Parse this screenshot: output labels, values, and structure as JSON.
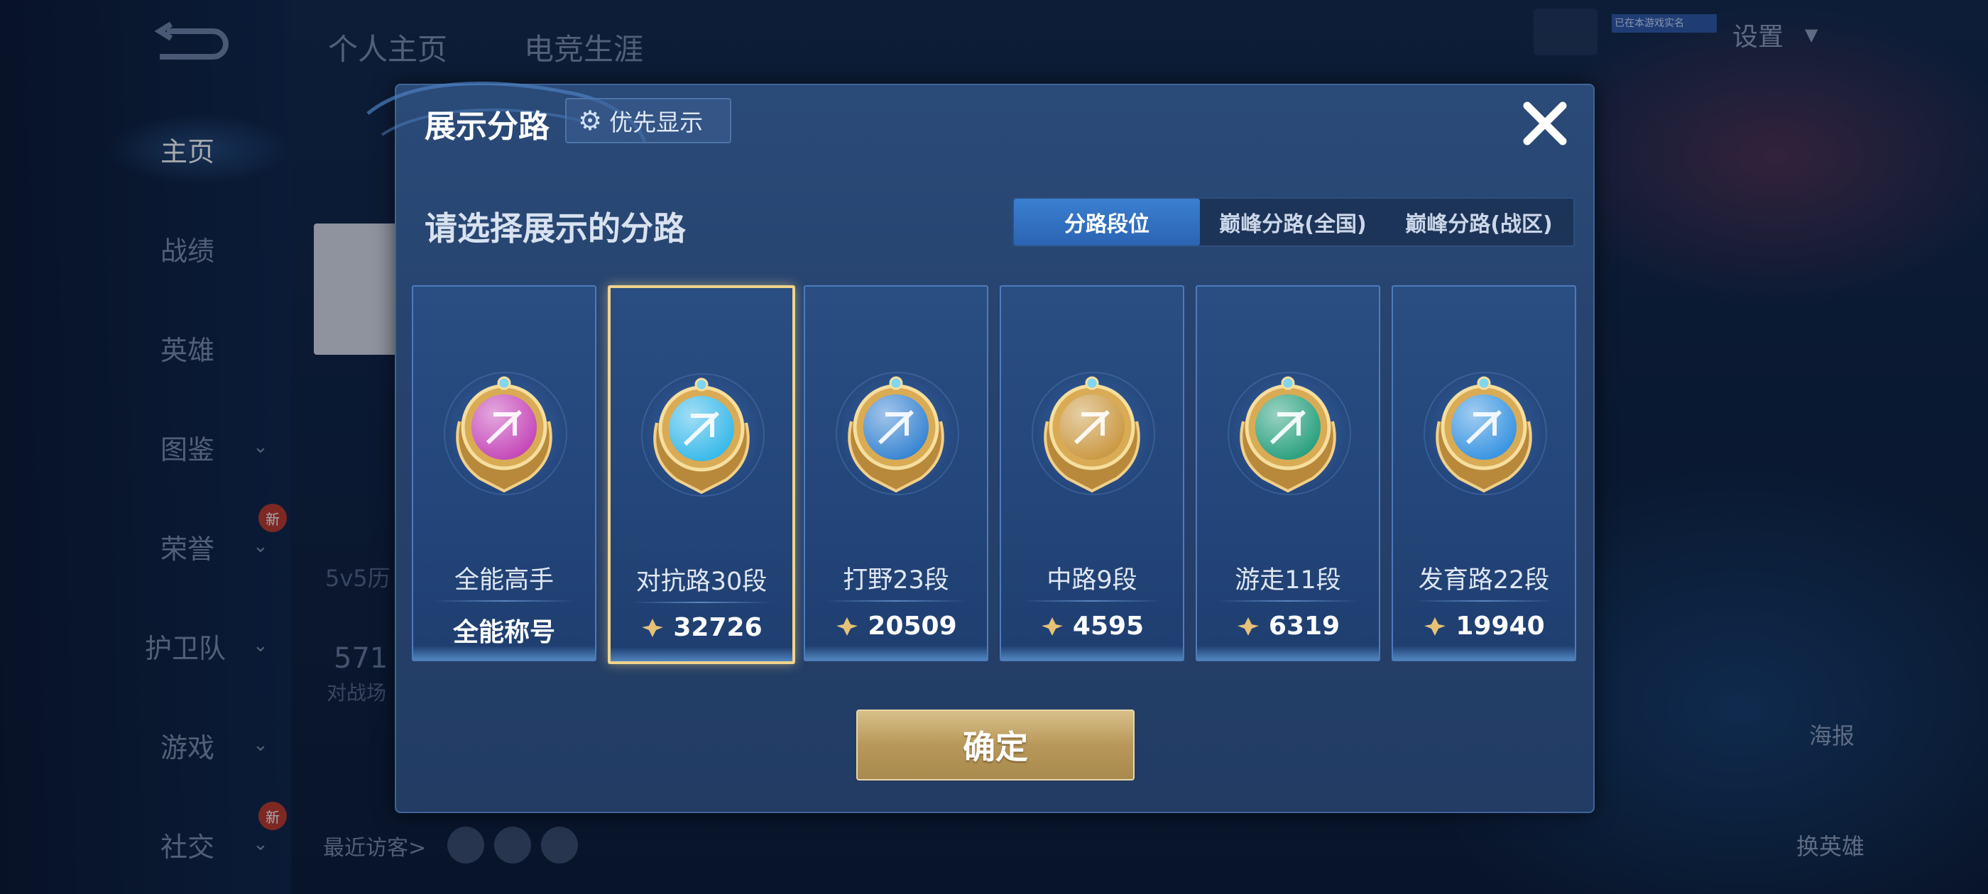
{
  "background": {
    "back_label": "",
    "top_tabs": [
      "个人主页",
      "电竞生涯"
    ],
    "settings_label": "设置",
    "realname_tag": "已在本游戏实名",
    "nav": [
      {
        "label": "主页",
        "active": true,
        "chevron": false
      },
      {
        "label": "战绩",
        "active": false,
        "chevron": false
      },
      {
        "label": "英雄",
        "active": false,
        "chevron": false
      },
      {
        "label": "图鉴",
        "active": false,
        "chevron": true
      },
      {
        "label": "荣誉",
        "active": false,
        "chevron": true
      },
      {
        "label": "护卫队",
        "active": false,
        "chevron": true
      },
      {
        "label": "游戏",
        "active": false,
        "chevron": true
      },
      {
        "label": "社交",
        "active": false,
        "chevron": true
      }
    ],
    "new_badge": "新",
    "history_text": "5v5历",
    "count_text": "571",
    "count_sub": "对战场",
    "visitors_label": "最近访客>",
    "right_buttons": {
      "poster": "海报",
      "swap_hero": "换英雄"
    }
  },
  "modal": {
    "title": "展示分路",
    "priority_label": "优先显示",
    "subtitle": "请选择展示的分路",
    "filter_tabs": [
      "分路段位",
      "巅峰分路(全国)",
      "巅峰分路(战区)"
    ],
    "active_filter_index": 0,
    "cards": [
      {
        "rank": "全能高手",
        "score": "全能称号",
        "has_score_icon": false,
        "selected": false,
        "badge_color": "#c23fb6"
      },
      {
        "rank": "对抗路30段",
        "score": "32726",
        "has_score_icon": true,
        "selected": true,
        "badge_color": "#2fb6e8"
      },
      {
        "rank": "打野23段",
        "score": "20509",
        "has_score_icon": true,
        "selected": false,
        "badge_color": "#2f7fd0"
      },
      {
        "rank": "中路9段",
        "score": "4595",
        "has_score_icon": true,
        "selected": false,
        "badge_color": "#c8943a"
      },
      {
        "rank": "游走11段",
        "score": "6319",
        "has_score_icon": true,
        "selected": false,
        "badge_color": "#1f9c78"
      },
      {
        "rank": "发育路22段",
        "score": "19940",
        "has_score_icon": true,
        "selected": false,
        "badge_color": "#2f8fe0"
      }
    ],
    "confirm_label": "确定"
  },
  "colors": {
    "accent_gold": "#f0d38a",
    "tab_active": "#3a7fd0",
    "modal_bg": "#26426c"
  }
}
